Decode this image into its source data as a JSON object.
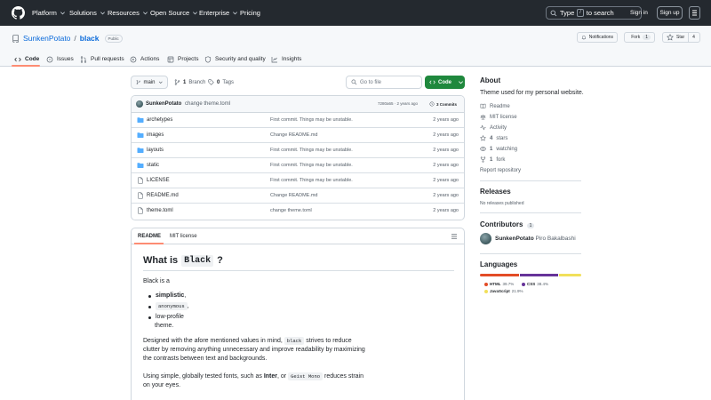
{
  "header": {
    "nav": [
      "Platform",
      "Solutions",
      "Resources",
      "Open Source",
      "Enterprise",
      "Pricing"
    ],
    "search_prefix": "Type",
    "search_key": "/",
    "search_suffix": "to search",
    "sign_in": "Sign in",
    "sign_up": "Sign up"
  },
  "repo": {
    "owner": "SunkenPotato",
    "separator": "/",
    "name": "black",
    "visibility": "Public",
    "notifications_label": "Notifications",
    "fork_label": "Fork",
    "fork_count": "1",
    "star_label": "Star",
    "star_count": "4"
  },
  "tabs": [
    "Code",
    "Issues",
    "Pull requests",
    "Actions",
    "Projects",
    "Security and quality",
    "Insights"
  ],
  "toolbar": {
    "branch": "main",
    "branch_count": "1",
    "branch_label": "Branch",
    "tag_count": "0",
    "tag_label": "Tags",
    "goto_placeholder": "Go to file",
    "code_button": "Code"
  },
  "latest_commit": {
    "author": "SunkenPotato",
    "message": "change theme.toml",
    "hash_time": "7280a65 · 2 years ago",
    "commits": "3 Commits"
  },
  "files": [
    {
      "name": "archetypes",
      "type": "folder",
      "commit": "First commit. Things may be unstable.",
      "age": "2 years ago"
    },
    {
      "name": "images",
      "type": "folder",
      "commit": "Change README.md",
      "age": "2 years ago"
    },
    {
      "name": "layouts",
      "type": "folder",
      "commit": "First commit. Things may be unstable.",
      "age": "2 years ago"
    },
    {
      "name": "static",
      "type": "folder",
      "commit": "First commit. Things may be unstable.",
      "age": "2 years ago"
    },
    {
      "name": "LICENSE",
      "type": "file",
      "commit": "First commit. Things may be unstable.",
      "age": "2 years ago"
    },
    {
      "name": "README.md",
      "type": "file",
      "commit": "Change README.md",
      "age": "2 years ago"
    },
    {
      "name": "theme.toml",
      "type": "file",
      "commit": "change theme.toml",
      "age": "2 years ago"
    }
  ],
  "readme": {
    "tabs": [
      "README",
      "MIT license"
    ],
    "h1_prefix": "What is",
    "h1_code": "Black",
    "h1_suffix": "?",
    "intro": "Black is a",
    "items": [
      "simplistic",
      ",",
      "anonymous",
      ",",
      "low-profile",
      "theme."
    ],
    "p1_a": "Designed with the afore mentioned values in mind,",
    "p1_code": "black",
    "p1_b": "strives to reduce",
    "p1_line2": "clutter by removing anything unnecessary and improve readability by maximizing",
    "p1_line3": "the contrasts between text and backgrounds.",
    "p2_a": "Using simple, globally tested fonts, such as",
    "p2_bold": "Inter",
    "p2_b": ", or",
    "p2_code": "Geist Mono",
    "p2_c": "reduces strain",
    "p2_line2": "on your eyes."
  },
  "sidebar": {
    "about_title": "About",
    "description": "Theme used for my personal website.",
    "links": [
      {
        "icon": "book-icon",
        "label": "Readme"
      },
      {
        "icon": "scale-icon",
        "label": "MIT license"
      },
      {
        "icon": "pulse-icon",
        "label": "Activity"
      },
      {
        "icon": "star-icon",
        "count": "4",
        "label": "stars"
      },
      {
        "icon": "eye-icon",
        "count": "1",
        "label": "watching"
      },
      {
        "icon": "fork-icon",
        "count": "1",
        "label": "fork"
      }
    ],
    "report": "Report repository",
    "releases_title": "Releases",
    "releases_text": "No releases published",
    "contributors_title": "Contributors",
    "contributors_count": "1",
    "contributor_login": "SunkenPotato",
    "contributor_name": "Piro Bakalbashi",
    "languages_title": "Languages",
    "languages": [
      {
        "name": "HTML",
        "percent": "39.7%",
        "value": 39.7,
        "color": "#e34c26"
      },
      {
        "name": "CSS",
        "percent": "38.4%",
        "value": 38.4,
        "color": "#663399"
      },
      {
        "name": "JavaScript",
        "percent": "21.9%",
        "value": 21.9,
        "color": "#f1e05a"
      }
    ]
  }
}
